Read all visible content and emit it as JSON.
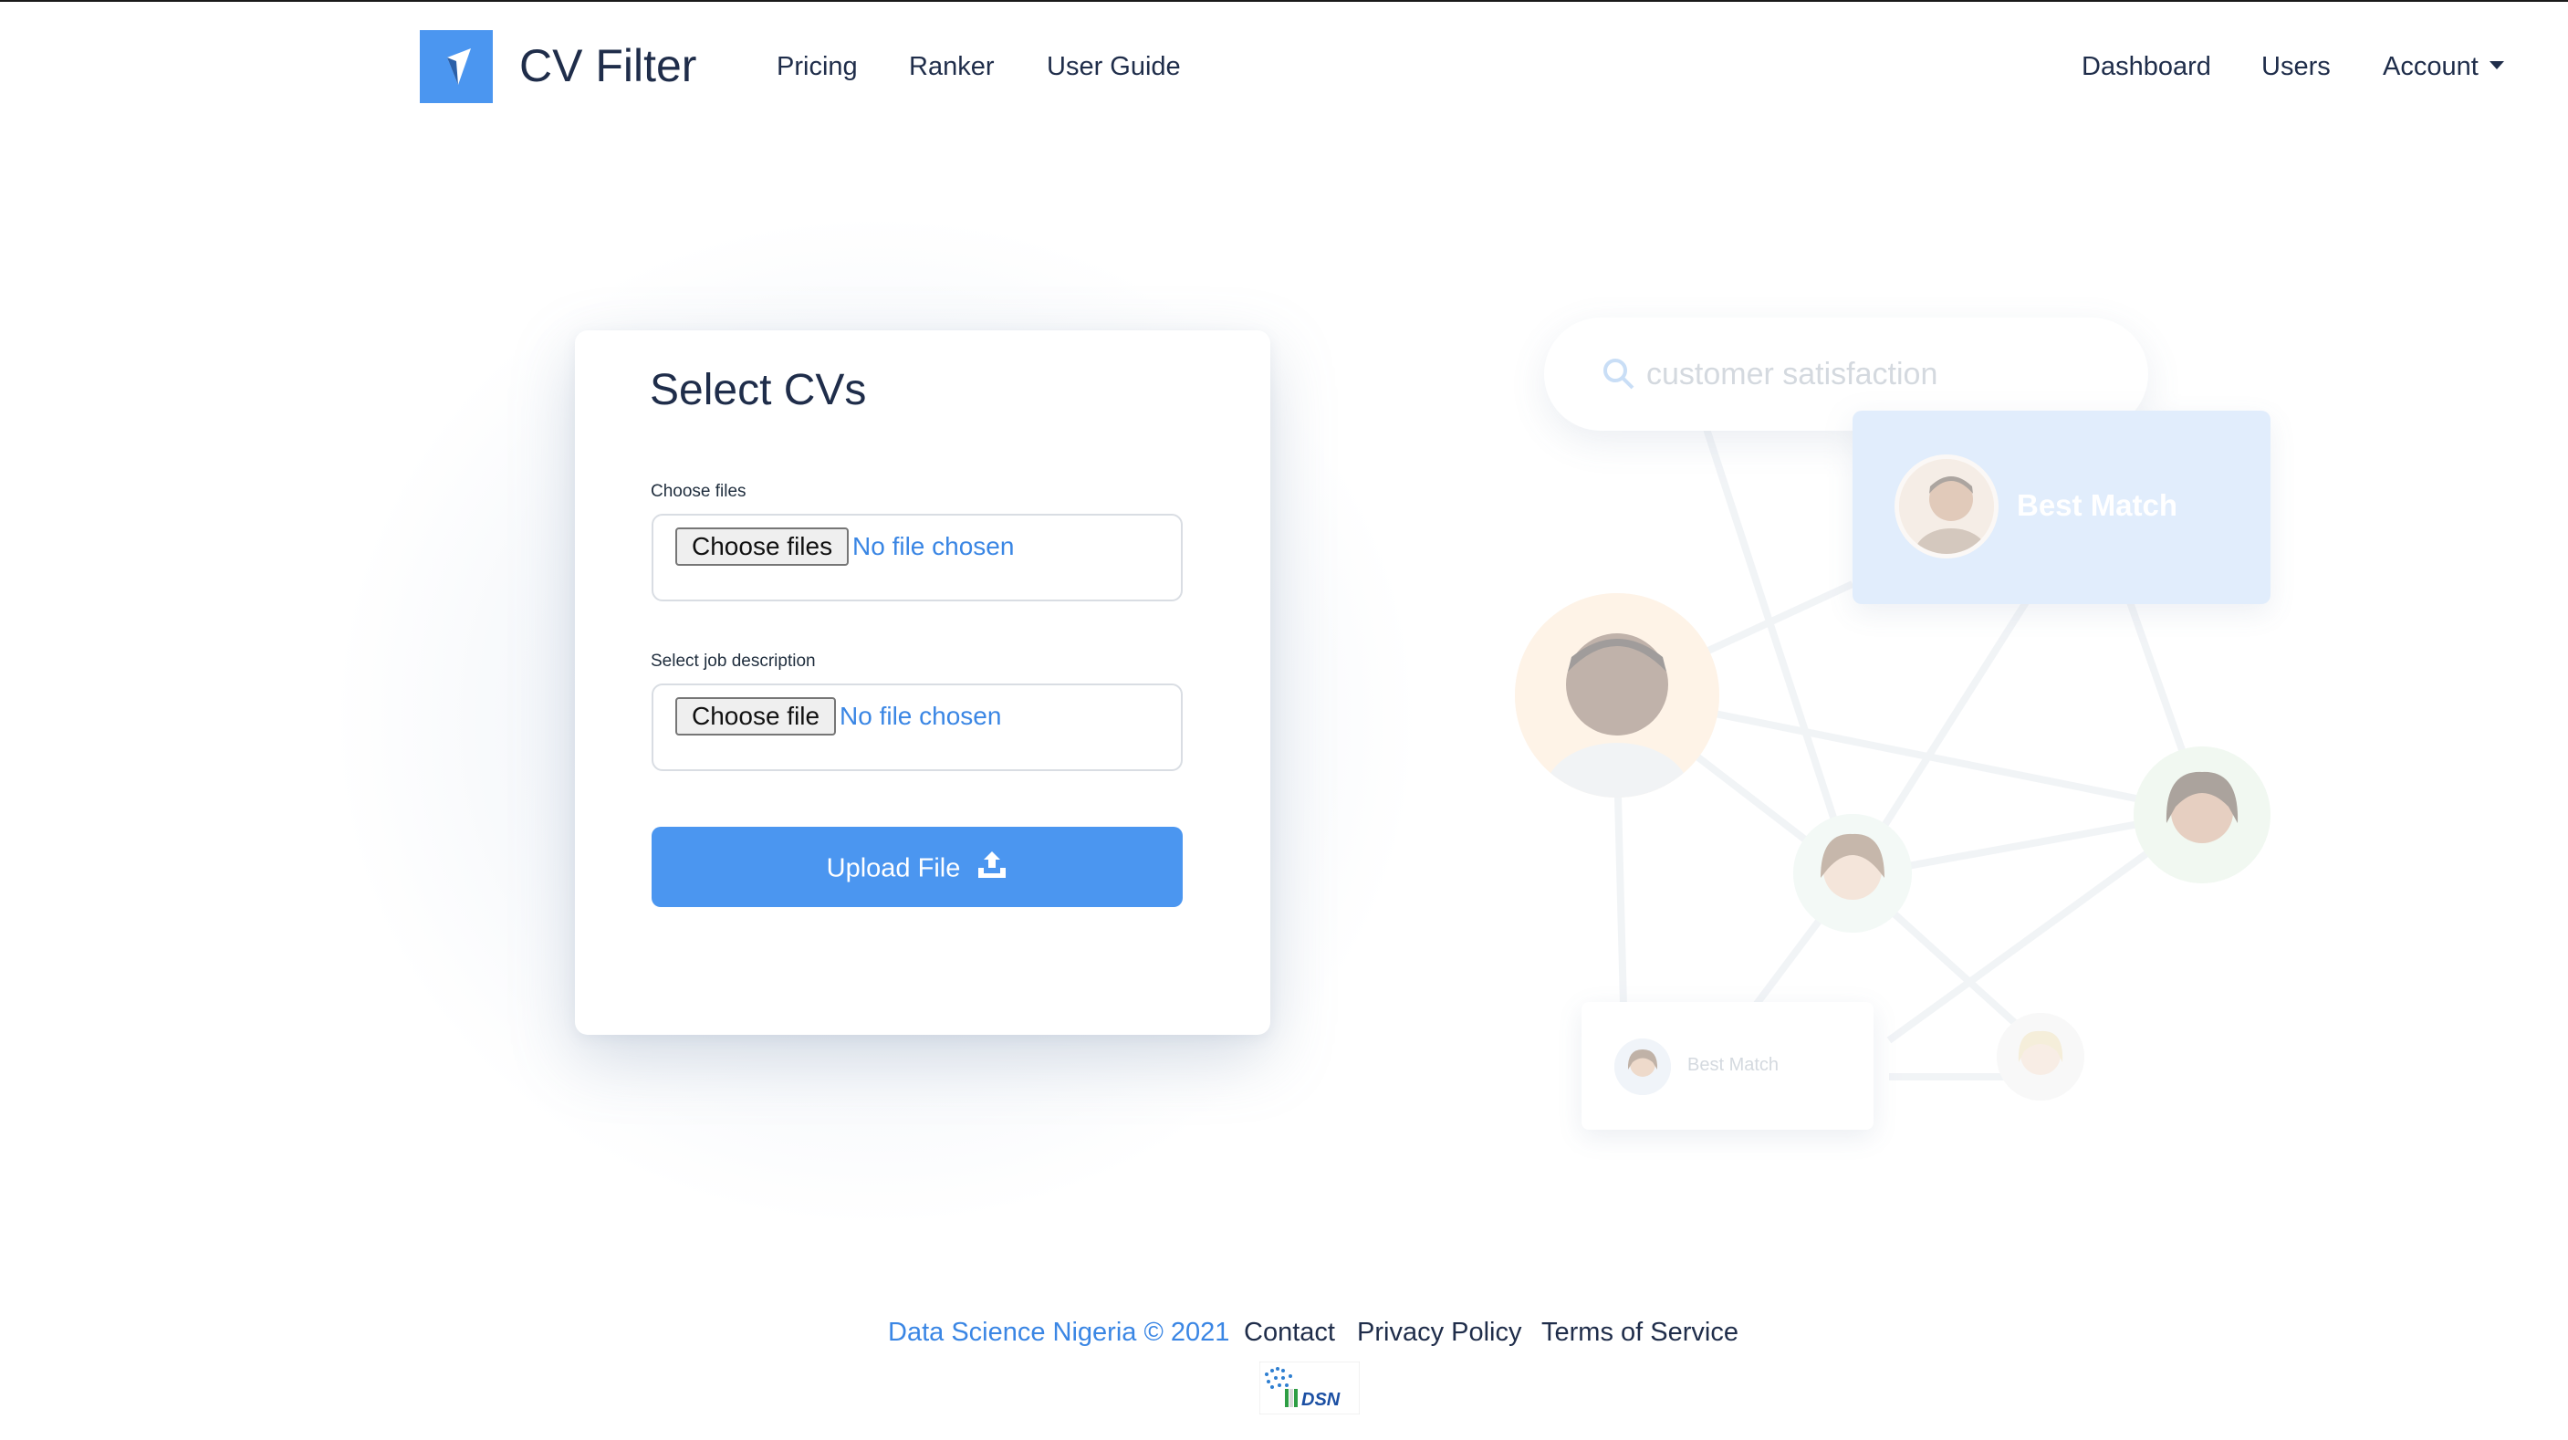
{
  "app": {
    "brand": "CV Filter"
  },
  "nav": {
    "left_links": [
      "Pricing",
      "Ranker",
      "User Guide"
    ],
    "right_links": [
      "Dashboard",
      "Users"
    ],
    "account_label": "Account"
  },
  "upload_card": {
    "title": "Select CVs",
    "cv_field": {
      "label": "Choose files",
      "button": "Choose files",
      "status": "No file chosen"
    },
    "jd_field": {
      "label": "Select job description",
      "button": "Choose file",
      "status": "No file chosen"
    },
    "upload_button": "Upload File"
  },
  "illustration": {
    "search_query": "customer satisfaction",
    "best_match_label": "Best Match",
    "small_card_label": "Best Match"
  },
  "footer": {
    "copyright": "Data Science Nigeria © 2021",
    "links": [
      "Contact",
      "Privacy Policy",
      "Terms of Service"
    ],
    "logo_text": "DSN"
  },
  "colors": {
    "accent": "#4b96f0",
    "link_blue": "#3a86e4",
    "text_dark": "#1f2d4a"
  },
  "icons": [
    "logo-mark-icon",
    "chevron-down-icon",
    "upload-icon",
    "search-icon"
  ]
}
